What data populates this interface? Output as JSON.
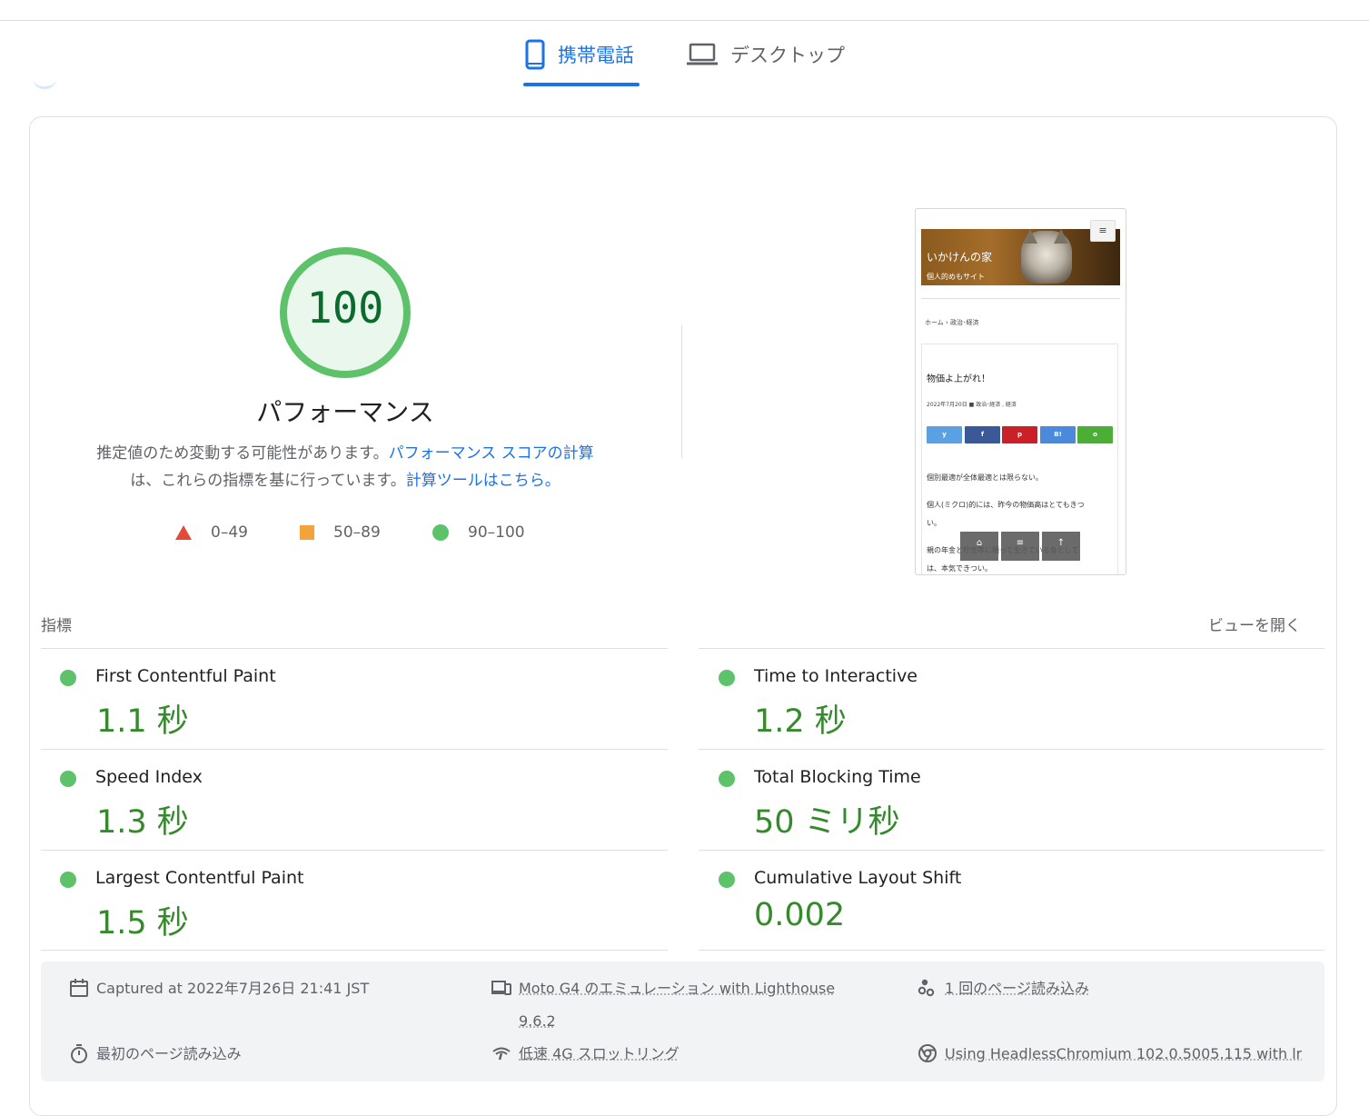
{
  "tabs": {
    "mobile_label": "携帯電話",
    "desktop_label": "デスクトップ"
  },
  "score": {
    "value": "100",
    "fraction": 1.0,
    "title": "パフォーマンス",
    "desc_text_1": "推定値のため変動する可能性があります。",
    "desc_link_1": "パフォーマンス スコアの計算",
    "desc_text_2": "は、これらの指標を基に行っています。",
    "desc_link_2": "計算ツールはこちら。"
  },
  "legend": [
    {
      "label": "0–49",
      "icon": "triangle-red",
      "color": "#e34a3a"
    },
    {
      "label": "50–89",
      "icon": "square-orange",
      "color": "#f2a33c"
    },
    {
      "label": "90–100",
      "icon": "circle-green",
      "color": "#5ec26a"
    }
  ],
  "preview": {
    "site_title": "いかけんの家",
    "site_subtitle": "個人的めもサイト",
    "menu_icon": "≡",
    "breadcrumb": "ホーム › 政治･経済",
    "post_title": "物価よ上がれ！",
    "post_meta": "2022年7月20日 ■ 政治･経済 , 経済",
    "share_buttons": [
      {
        "label": "y",
        "color": "#5aa1e3"
      },
      {
        "label": "f",
        "color": "#3b5998"
      },
      {
        "label": "p",
        "color": "#cb2027"
      },
      {
        "label": "B!",
        "color": "#4a89dc"
      },
      {
        "label": "o",
        "color": "#4caf35"
      }
    ],
    "paragraphs": [
      "個別最適が全体最適とは限らない。",
      "個人(ミクロ)的には、昨今の物価高はとてもきつ",
      "い。",
      "親の年金と貯金等に頼って生きている身として",
      "は、本気できつい。"
    ],
    "float_buttons": [
      "⌂",
      "≡",
      "↑"
    ]
  },
  "metrics_section": {
    "label": "指標",
    "open_view": "ビューを開く"
  },
  "metrics": [
    {
      "name": "First Contentful Paint",
      "value": "1.1 秒"
    },
    {
      "name": "Time to Interactive",
      "value": "1.2 秒"
    },
    {
      "name": "Speed Index",
      "value": "1.3 秒"
    },
    {
      "name": "Total Blocking Time",
      "value": "50 ミリ秒"
    },
    {
      "name": "Largest Contentful Paint",
      "value": "1.5 秒"
    },
    {
      "name": "Cumulative Layout Shift",
      "value": "0.002"
    }
  ],
  "info": {
    "captured": "Captured at 2022年7月26日 21:41 JST",
    "device": "Moto G4 のエミュレーション with Lighthouse",
    "device_version": "9.6.2",
    "page_loads": "1 回のページ読み込み",
    "first_load": "最初のページ読み込み",
    "throttling": "低速 4G スロットリング",
    "browser": "Using HeadlessChromium 102.0.5005.115 with lr"
  },
  "colors": {
    "accent": "#1a73e8",
    "pass": "#5ec26a",
    "pass_text": "#358a2b"
  }
}
